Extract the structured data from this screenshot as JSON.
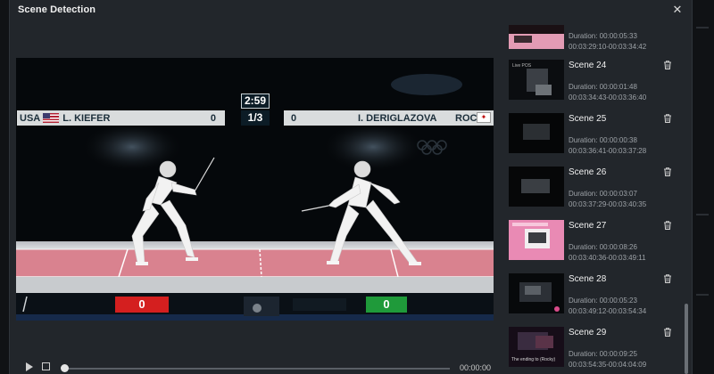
{
  "window": {
    "title": "Scene Detection",
    "close_glyph": "✕"
  },
  "video": {
    "scoreboard": {
      "left_country": "USA",
      "left_name": "L. KIEFER",
      "left_score": "0",
      "clock": "2:59",
      "period": "1/3",
      "right_score": "0",
      "right_name": "I. DERIGLAZOVA",
      "right_country": "ROC"
    },
    "light_red_score": "0",
    "light_green_score": "0"
  },
  "transport": {
    "play_icon": "play-icon",
    "stop_icon": "stop-icon",
    "progress": 0,
    "timecode": "00:00:00"
  },
  "scenes": [
    {
      "name": "",
      "duration": "Duration: 00:00:05:33",
      "range": "00:03:29:10-00:03:34:42",
      "thumb": "pink"
    },
    {
      "name": "Scene 24",
      "duration": "Duration: 00:00:01:48",
      "range": "00:03:34:43-00:03:36:40",
      "thumb": "dark-text",
      "thumb_caption": "Live POS"
    },
    {
      "name": "Scene 25",
      "duration": "Duration: 00:00:00:38",
      "range": "00:03:36:41-00:03:37:28",
      "thumb": "dark"
    },
    {
      "name": "Scene 26",
      "duration": "Duration: 00:00:03:07",
      "range": "00:03:37:29-00:03:40:35",
      "thumb": "dark"
    },
    {
      "name": "Scene 27",
      "duration": "Duration: 00:00:08:26",
      "range": "00:03:40:36-00:03:49:11",
      "thumb": "pink-screen"
    },
    {
      "name": "Scene 28",
      "duration": "Duration: 00:00:05:23",
      "range": "00:03:49:12-00:03:54:34",
      "thumb": "dark-screen"
    },
    {
      "name": "Scene 29",
      "duration": "Duration: 00:00:09:25",
      "range": "00:03:54:35-00:04:04:09",
      "thumb": "dark-caption",
      "thumb_caption": "The ending to (Rocky)"
    }
  ],
  "scrollbar": {
    "position": 0.8
  },
  "colors": {
    "dialog_bg": "#22262b",
    "red_light": "#d41f1f",
    "green_light": "#1f9a3a",
    "piste": "#d9828f"
  }
}
